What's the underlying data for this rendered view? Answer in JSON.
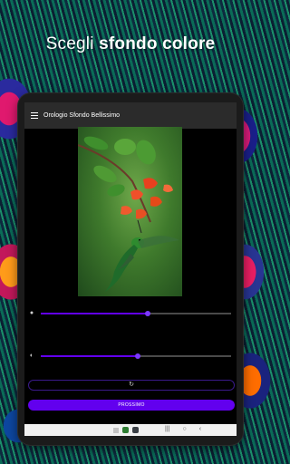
{
  "headline": {
    "normal": "Scegli",
    "bold": "sfondo colore"
  },
  "app": {
    "title": "Orologio Sfondo Bellissimo"
  },
  "sliders": [
    {
      "icon": "palette-icon",
      "value_fraction": 0.56
    },
    {
      "icon": "brightness-icon",
      "value_fraction": 0.51
    }
  ],
  "reset": {
    "icon": "refresh-icon",
    "glyph": "↻"
  },
  "next": {
    "label": "PROSSIMO"
  },
  "colors": {
    "accent": "#6200ee",
    "appbar": "#2b2b2b",
    "background": "#000000"
  },
  "navbar": {
    "apps": [
      "#2e7d32",
      "#3a3f45"
    ],
    "recent_glyph": "|||",
    "home_glyph": "○",
    "back_glyph": "‹"
  }
}
